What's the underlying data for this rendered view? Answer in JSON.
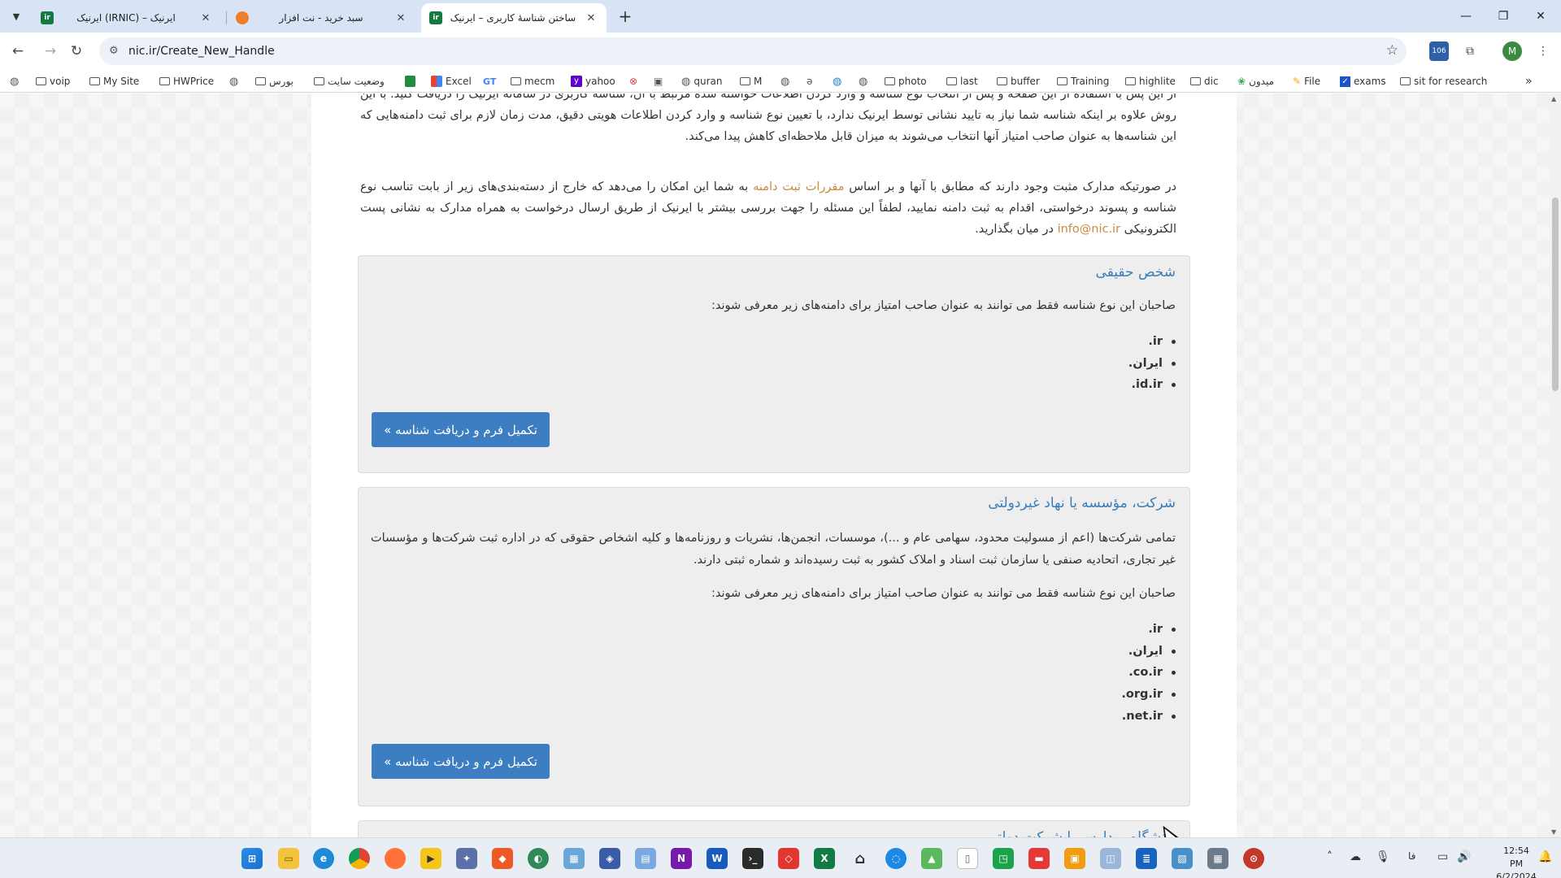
{
  "browser": {
    "tabs": [
      {
        "title": "ایرنیک (IRNIC) – ایرنیک",
        "favicon_color": "#127a3e",
        "active": false
      },
      {
        "title": "سبد خرید - نت افزار",
        "favicon_color": "#f07d28",
        "active": false
      },
      {
        "title": "ساختن شناسهٔ کاربری – ایرنیک",
        "favicon_color": "#127a3e",
        "active": true
      }
    ],
    "url": "nic.ir/Create_New_Handle",
    "profile_initial": "M",
    "extension_badge": "106",
    "bookmarks": [
      {
        "label": "voip",
        "type": "folder"
      },
      {
        "label": "My Site",
        "type": "folder"
      },
      {
        "label": "HWPrice",
        "type": "folder"
      },
      {
        "label": "",
        "type": "globe"
      },
      {
        "label": "بورس",
        "type": "folder"
      },
      {
        "label": "وضعیت سایت",
        "type": "folder"
      },
      {
        "label": "",
        "type": "sheets"
      },
      {
        "label": "Excel",
        "type": "app"
      },
      {
        "label": "",
        "type": "translate"
      },
      {
        "label": "mecm",
        "type": "folder"
      },
      {
        "label": "yahoo",
        "type": "yahoo"
      },
      {
        "label": "",
        "type": "app"
      },
      {
        "label": "",
        "type": "app"
      },
      {
        "label": "quran",
        "type": "globe"
      },
      {
        "label": "M",
        "type": "folder"
      },
      {
        "label": "",
        "type": "globe"
      },
      {
        "label": "",
        "type": "app"
      },
      {
        "label": "",
        "type": "globe"
      },
      {
        "label": "",
        "type": "globe"
      },
      {
        "label": "photo",
        "type": "folder"
      },
      {
        "label": "last",
        "type": "folder"
      },
      {
        "label": "buffer",
        "type": "folder"
      },
      {
        "label": "Training",
        "type": "folder"
      },
      {
        "label": "highlite",
        "type": "folder"
      },
      {
        "label": "dic",
        "type": "folder"
      },
      {
        "label": "میدون",
        "type": "app"
      },
      {
        "label": "File",
        "type": "app"
      },
      {
        "label": "exams",
        "type": "app"
      },
      {
        "label": "sit for research",
        "type": "folder"
      }
    ]
  },
  "page": {
    "intro": "از این پس با استفاده از این صفحه و پس از انتخاب نوع شناسه و وارد کردن اطلاعات خواسته شده مرتبط با آن، شناسه کاربری در سامانه ایرنیک را دریافت کنید. با این روش علاوه بر اینکه شناسه شما نیاز به تایید نشانی توسط ایرنیک ندارد، با تعیین نوع شناسه و وارد کردن اطلاعات هویتی دقیق، مدت زمان لازم برای ثبت دامنه‌هایی که این شناسه‌ها به عنوان صاحب امتیاز آنها انتخاب می‌شوند به میزان قابل ملاحظه‌ای کاهش پیدا می‌کند.",
    "note_part1": "در صورتیکه مدارک مثبت وجود دارند که مطابق با آنها و بر اساس",
    "note_link": "مقررات ثبت دامنه",
    "note_part2": "به شما این امکان را می‌دهد که خارج از دسته‌بندی‌های زیر از بابت تناسب نوع شناسه و پسوند درخواستی، اقدام به ثبت دامنه نمایید، لطفاً این مسئله را جهت بررسی بیشتر با ایرنیک از طریق ارسال درخواست به همراه مدارک به نشانی پست الکترونیکی",
    "note_email": "info@nic.ir",
    "note_part3": "در میان بگذارید.",
    "sections": [
      {
        "title": "شخص حقیقی",
        "description": "",
        "eligibility": "صاحبان این نوع شناسه فقط می توانند به عنوان صاحب امتیاز برای دامنه‌های زیر معرفی شوند:",
        "domains": [
          ".ir",
          ".ایران",
          ".id.ir"
        ],
        "button": "تکمیل فرم و دریافت شناسه »"
      },
      {
        "title": "شرکت، مؤسسه یا نهاد غیردولتی",
        "description": "تمامی شرکت‌ها (اعم از مسولیت محدود، سهامی عام و ...)، موسسات، انجمن‌ها، نشریات و روزنامه‌ها و کلیه اشخاص حقوقی که در اداره ثبت شرکت‌ها و مؤسسات غیر تجاری، اتحادیه صنفی یا سازمان ثبت اسناد و املاک کشور به ثبت رسیده‌اند و شماره ثبتی دارند.",
        "eligibility": "صاحبان این نوع شناسه فقط می توانند به عنوان صاحب امتیاز برای دامنه‌های زیر معرفی شوند:",
        "domains": [
          ".ir",
          ".ایران",
          ".co.ir",
          ".org.ir",
          ".net.ir"
        ],
        "button": "تکمیل فرم و دریافت شناسه »"
      },
      {
        "title": "دانشگاه، مدارس یا شرکت دولتی",
        "description": "",
        "eligibility": "",
        "domains": [],
        "button": ""
      }
    ]
  },
  "taskbar": {
    "time": "12:54 PM",
    "date": "6/2/2024",
    "lang": "فا"
  },
  "colors": {
    "accent_button": "#3c7ec1",
    "panel_title": "#3b7db8",
    "link": "#c98a3e",
    "panel_bg": "#eeeeee"
  }
}
